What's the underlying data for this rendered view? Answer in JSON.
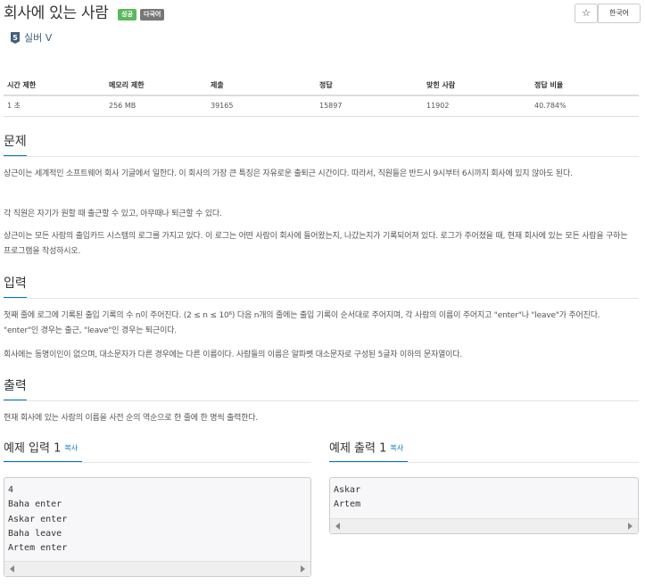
{
  "header": {
    "title": "회사에 있는 사람",
    "badges": [
      "성공",
      "다국어"
    ],
    "star_icon": "star-icon",
    "language_button": "한국어",
    "tier_icon_number": "5",
    "tier_label": "실버 V"
  },
  "stats": {
    "headers": [
      "시간 제한",
      "메모리 제한",
      "제출",
      "정답",
      "맞힌 사람",
      "정답 비율"
    ],
    "values": [
      "1 초",
      "256 MB",
      "39165",
      "15897",
      "11902",
      "40.784%"
    ]
  },
  "problem": {
    "title": "문제",
    "paragraphs": [
      "상근이는 세계적인 소프트웨어 회사 기글에서 일한다. 이 회사의 가장 큰 특징은 자유로운 출퇴근 시간이다. 따라서, 직원들은 반드시 9시부터 6시까지 회사에 있지 않아도 된다.",
      "각 직원은 자기가 원할 때 출근할 수 있고, 아무때나 퇴근할 수 있다.",
      "상근이는 모든 사람의 출입카드 시스템의 로그를 가지고 있다. 이 로그는 어떤 사람이 회사에 들어왔는지, 나갔는지가 기록되어져 있다. 로그가 주어졌을 때, 현재 회사에 있는 모든 사람을 구하는 프로그램을 작성하시오."
    ]
  },
  "input": {
    "title": "입력",
    "paragraphs": [
      "첫째 줄에 로그에 기록된 출입 기록의 수 n이 주어진다. (2 ≤ n ≤ 10⁶) 다음 n개의 줄에는 출입 기록이 순서대로 주어지며, 각 사람의 이름이 주어지고 \"enter\"나 \"leave\"가 주어진다. \"enter\"인 경우는 출근, \"leave\"인 경우는 퇴근이다.",
      "회사에는 동명이인이 없으며, 대소문자가 다른 경우에는 다른 이름이다. 사람들의 이름은 알파벳 대소문자로 구성된 5글자 이하의 문자열이다."
    ]
  },
  "output": {
    "title": "출력",
    "paragraphs": [
      "현재 회사에 있는 사람의 이름을 사전 순의 역순으로 한 줄에 한 명씩 출력한다."
    ]
  },
  "samples": {
    "input_title": "예제 입력 1",
    "output_title": "예제 출력 1",
    "copy_label": "복사",
    "input_lines": [
      "4",
      "Baha enter",
      "Askar enter",
      "Baha leave",
      "Artem enter"
    ],
    "output_lines": [
      "Askar",
      "Artem"
    ]
  },
  "colors": {
    "accent": "#0076c0",
    "success_badge": "#5cb85c",
    "multilang_badge": "#777777",
    "tier_silver": "#435f7a"
  }
}
